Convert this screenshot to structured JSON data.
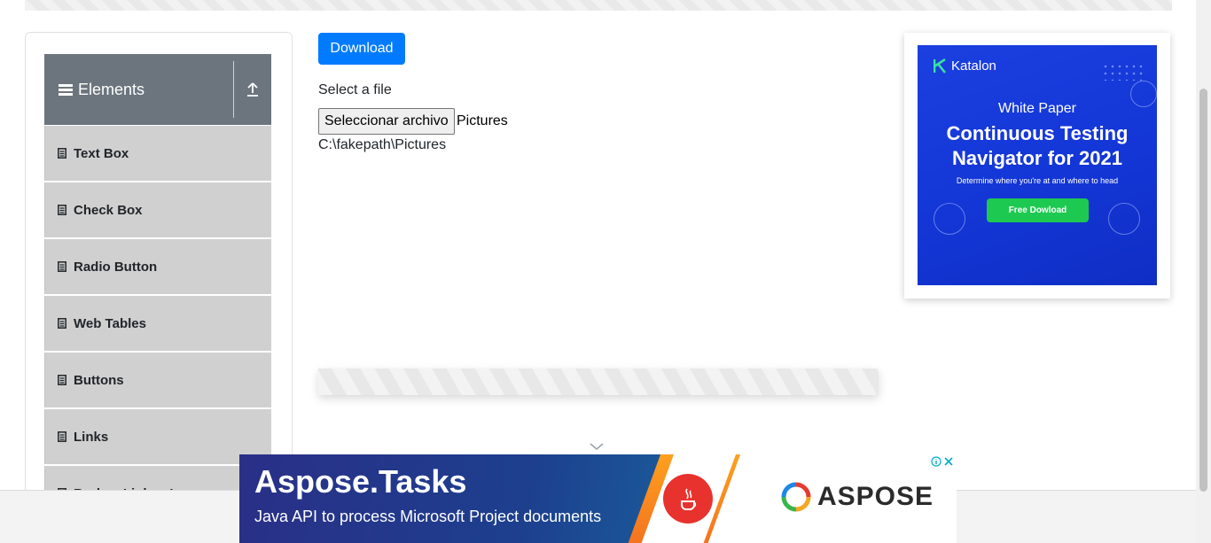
{
  "sidebar": {
    "group_title": "Elements",
    "items": [
      {
        "label": "Text Box"
      },
      {
        "label": "Check Box"
      },
      {
        "label": "Radio Button"
      },
      {
        "label": "Web Tables"
      },
      {
        "label": "Buttons"
      },
      {
        "label": "Links"
      },
      {
        "label": "Broken Links - Images"
      }
    ]
  },
  "main": {
    "download_label": "Download",
    "select_label": "Select a file",
    "file_button_label": "Seleccionar archivo",
    "file_name": "Pictures",
    "uploaded_path": "C:\\fakepath\\Pictures"
  },
  "right_ad": {
    "brand": "Katalon",
    "subtitle": "White Paper",
    "title_line1": "Continuous Testing",
    "title_line2": "Navigator for 2021",
    "description": "Determine where you're at and where to head",
    "cta": "Free Dowload"
  },
  "bottom_ad": {
    "title": "Aspose.Tasks",
    "subtitle": "Java API to process Microsoft Project documents",
    "brand": "ASPOSE"
  },
  "icons": [
    "hamburger-icon",
    "upload-icon",
    "document-icon",
    "chevron-down-icon",
    "info-icon",
    "close-icon",
    "java-icon",
    "katalon-logo-icon",
    "aspose-logo-icon"
  ],
  "colors": {
    "primary": "#007bff",
    "nav_header": "#6c757d",
    "nav_item": "#d0d0d0",
    "ad_blue": "#1437d8",
    "ad_green": "#1dc950"
  }
}
